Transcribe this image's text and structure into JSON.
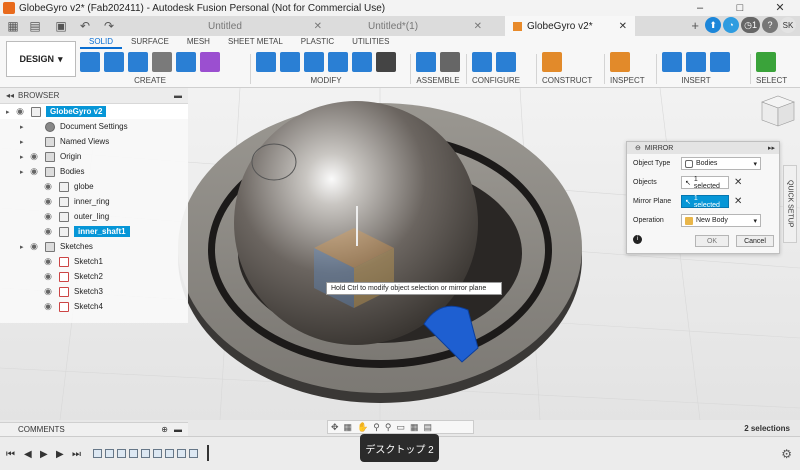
{
  "window": {
    "title": "GlobeGyro v2* (Fab202411) - Autodesk Fusion Personal (Not for Commercial Use)",
    "controls": [
      "–",
      "□",
      "✕"
    ]
  },
  "tabs": [
    {
      "label": "Untitled",
      "active": false
    },
    {
      "label": "Untitled*(1)",
      "active": false
    },
    {
      "label": "GlobeGyro v2*",
      "active": true
    }
  ],
  "tab_right": {
    "job_count": "1",
    "avatar": "SK"
  },
  "ribbon": {
    "workspace": "DESIGN",
    "tabs": [
      "SOLID",
      "SURFACE",
      "MESH",
      "SHEET METAL",
      "PLASTIC",
      "UTILITIES"
    ],
    "active_tab": "SOLID",
    "groups": [
      {
        "label": "CREATE",
        "icons": [
          "#2a7fd4",
          "#2a7fd4",
          "#2a7fd4",
          "#7a7a7a",
          "#2a7fd4",
          "#9b4fd0"
        ]
      },
      {
        "label": "MODIFY",
        "icons": [
          "#2a7fd4",
          "#2a7fd4",
          "#2a7fd4",
          "#2a7fd4",
          "#2a7fd4",
          "#444444"
        ]
      },
      {
        "label": "ASSEMBLE",
        "icons": [
          "#2a7fd4",
          "#666666"
        ]
      },
      {
        "label": "CONFIGURE",
        "icons": [
          "#2a7fd4",
          "#2a7fd4"
        ]
      },
      {
        "label": "CONSTRUCT",
        "icons": [
          "#e28a2a"
        ]
      },
      {
        "label": "INSPECT",
        "icons": [
          "#e28a2a"
        ]
      },
      {
        "label": "INSERT",
        "icons": [
          "#2a7fd4",
          "#2a7fd4",
          "#2a7fd4"
        ]
      },
      {
        "label": "SELECT",
        "icons": [
          "#3aa33a"
        ]
      }
    ]
  },
  "browser": {
    "title": "BROWSER",
    "items": [
      {
        "label": "GlobeGyro v2",
        "level": 0,
        "selected": true
      },
      {
        "label": "Document Settings",
        "level": 1
      },
      {
        "label": "Named Views",
        "level": 1
      },
      {
        "label": "Origin",
        "level": 1
      },
      {
        "label": "Bodies",
        "level": 1
      },
      {
        "label": "globe",
        "level": 2
      },
      {
        "label": "inner_ring",
        "level": 2
      },
      {
        "label": "outer_ling",
        "level": 2
      },
      {
        "label": "inner_shaft1",
        "level": 2,
        "selected": true
      },
      {
        "label": "Sketches",
        "level": 1
      },
      {
        "label": "Sketch1",
        "level": 2
      },
      {
        "label": "Sketch2",
        "level": 2
      },
      {
        "label": "Sketch3",
        "level": 2
      },
      {
        "label": "Sketch4",
        "level": 2
      }
    ]
  },
  "mirror": {
    "title": "MIRROR",
    "rows": {
      "object_type": {
        "label": "Object Type",
        "value": "Bodies"
      },
      "objects": {
        "label": "Objects",
        "value": "1 selected"
      },
      "mirror_plane": {
        "label": "Mirror Plane",
        "value": "1 selected"
      },
      "operation": {
        "label": "Operation",
        "value": "New Body"
      }
    },
    "ok": "OK",
    "cancel": "Cancel"
  },
  "quick_setup": "QUICK SETUP",
  "tooltip": "Hold Ctrl to modify object selection or mirror plane",
  "comments": "COMMENTS",
  "selection_count": "2 selections",
  "toast": "デスクトップ 2"
}
